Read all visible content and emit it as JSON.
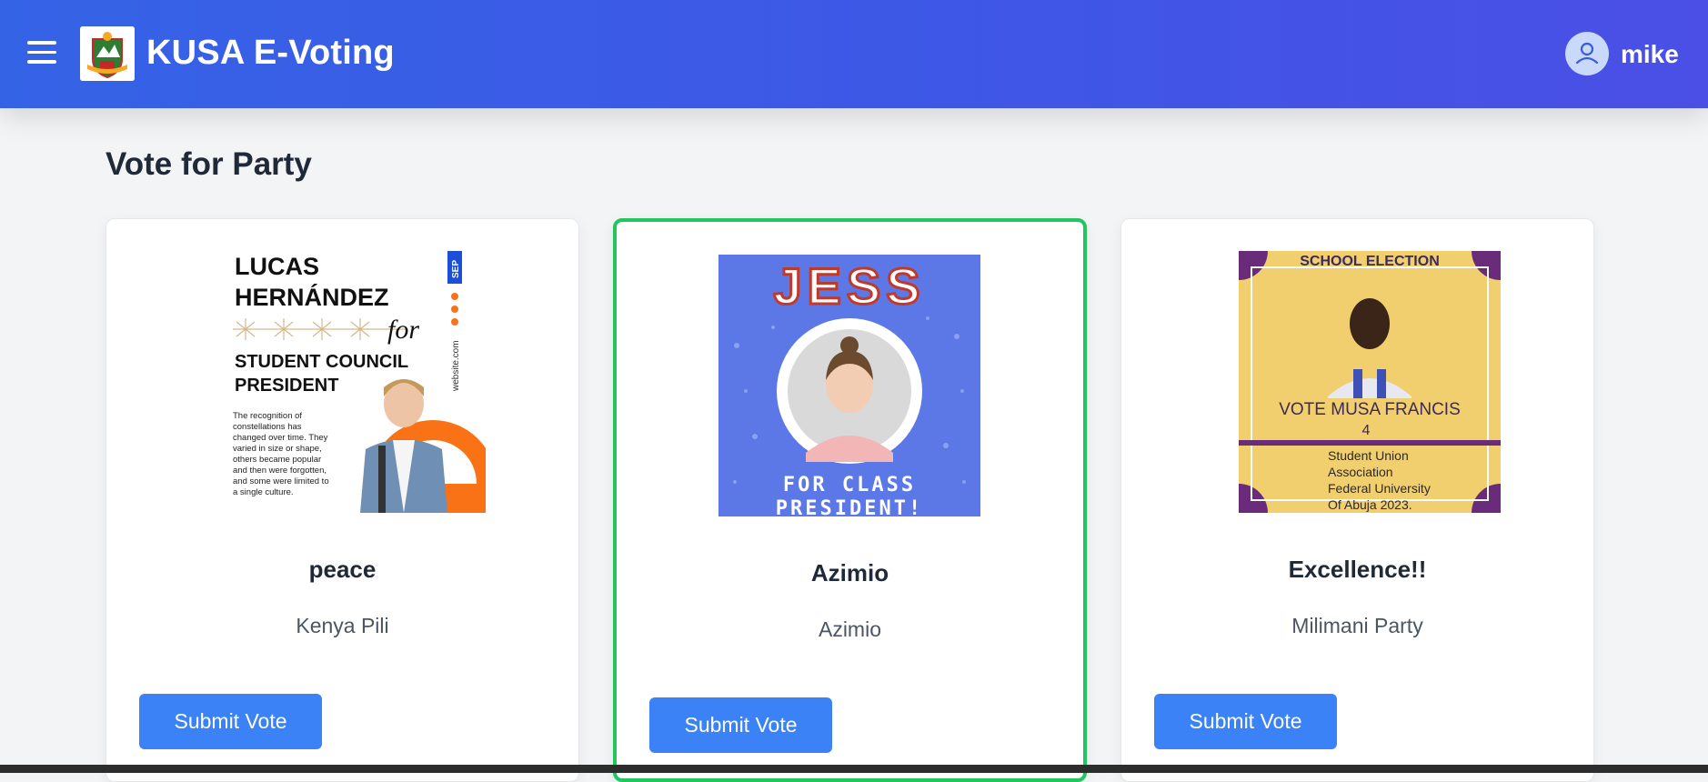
{
  "header": {
    "app_title": "KUSA E-Voting",
    "user_name": "mike",
    "icons": [
      "hamburger-menu-icon",
      "user-icon"
    ],
    "colors": {
      "gradient_start": "#3563e6",
      "gradient_end": "#4b4fe6"
    }
  },
  "main": {
    "page_title": "Vote for Party",
    "cards": [
      {
        "candidate": "peace",
        "party": "Kenya Pili",
        "button_label": "Submit Vote",
        "selected": false,
        "poster": {
          "line1": "LUCAS",
          "line2": "HERNÁNDEZ",
          "for": "for",
          "position1": "STUDENT COUNCIL",
          "position2": "PRESIDENT",
          "side_tag": "SEP",
          "side_site": "website.com",
          "body": "The recognition of constellations has changed over time. They varied in size or shape, others became popular and then were forgotten, and some were limited to a single culture."
        }
      },
      {
        "candidate": "Azimio",
        "party": "Azimio",
        "button_label": "Submit Vote",
        "selected": true,
        "poster": {
          "headline": "JESS",
          "footer1": "FOR CLASS",
          "footer2": "PRESIDENT!"
        }
      },
      {
        "candidate": "Excellence!!",
        "party": "Milimani Party",
        "button_label": "Submit Vote",
        "selected": false,
        "poster": {
          "top": "SCHOOL ELECTION",
          "vote_line": "VOTE  MUSA FRANCIS",
          "number": "4",
          "org1": "Student Union",
          "org2": "Association",
          "org3": "Federal University",
          "org4": "Of Abuja 2023."
        }
      }
    ],
    "colors": {
      "selected_border": "#22c55e",
      "button": "#3b82f6"
    }
  }
}
